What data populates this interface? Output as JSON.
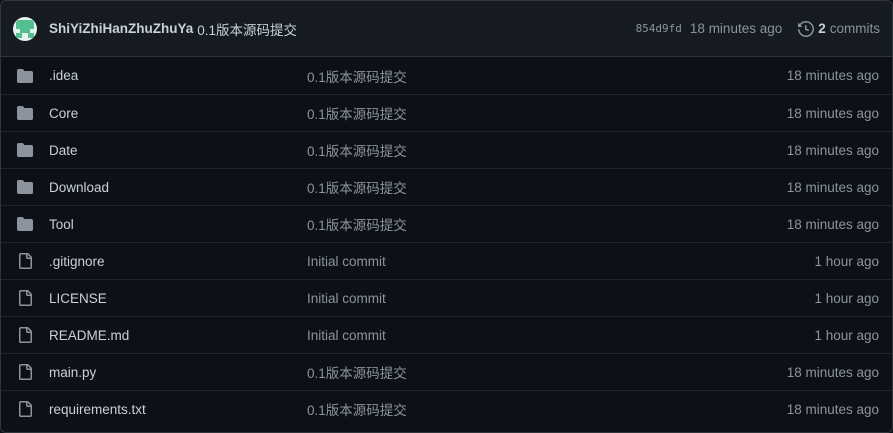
{
  "latest_commit": {
    "author": "ShiYiZhiHanZhuZhuYa",
    "message": "0.1版本源码提交",
    "sha": "854d9fd",
    "time": "18 minutes ago",
    "commits_count": "2",
    "commits_label": "commits"
  },
  "colors": {
    "background": "#0d1117",
    "header_bg": "#161b22",
    "border": "#30363d",
    "icon": "#8b949e",
    "text": "#c9d1d9",
    "muted": "#8b949e"
  },
  "files": [
    {
      "name": ".idea",
      "type": "folder",
      "icon": "folder-icon",
      "message": "0.1版本源码提交",
      "time": "18 minutes ago"
    },
    {
      "name": "Core",
      "type": "folder",
      "icon": "folder-icon",
      "message": "0.1版本源码提交",
      "time": "18 minutes ago"
    },
    {
      "name": "Date",
      "type": "folder",
      "icon": "folder-icon",
      "message": "0.1版本源码提交",
      "time": "18 minutes ago"
    },
    {
      "name": "Download",
      "type": "folder",
      "icon": "folder-icon",
      "message": "0.1版本源码提交",
      "time": "18 minutes ago"
    },
    {
      "name": "Tool",
      "type": "folder",
      "icon": "folder-icon",
      "message": "0.1版本源码提交",
      "time": "18 minutes ago"
    },
    {
      "name": ".gitignore",
      "type": "file",
      "icon": "file-icon",
      "message": "Initial commit",
      "time": "1 hour ago"
    },
    {
      "name": "LICENSE",
      "type": "file",
      "icon": "file-icon",
      "message": "Initial commit",
      "time": "1 hour ago"
    },
    {
      "name": "README.md",
      "type": "file",
      "icon": "file-icon",
      "message": "Initial commit",
      "time": "1 hour ago"
    },
    {
      "name": "main.py",
      "type": "file",
      "icon": "file-icon",
      "message": "0.1版本源码提交",
      "time": "18 minutes ago"
    },
    {
      "name": "requirements.txt",
      "type": "file",
      "icon": "file-icon",
      "message": "0.1版本源码提交",
      "time": "18 minutes ago"
    }
  ]
}
